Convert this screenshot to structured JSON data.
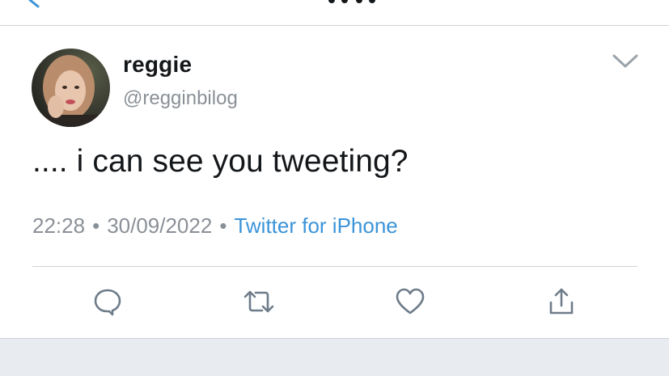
{
  "tweet": {
    "display_name": "reggie",
    "handle": "@regginbilog",
    "text": ".... i can see you tweeting?",
    "time": "22:28",
    "date": "30/09/2022",
    "source": "Twitter for iPhone",
    "separator": "•"
  },
  "colors": {
    "link": "#3b94d9",
    "muted": "#8a9097",
    "text": "#14171a",
    "icon": "#6e7c8a"
  },
  "icons": {
    "back": "chevron-left-icon",
    "more": "chevron-down-icon",
    "reply": "speech-bubble-icon",
    "retweet": "retweet-icon",
    "like": "heart-icon",
    "share": "share-upload-icon"
  }
}
